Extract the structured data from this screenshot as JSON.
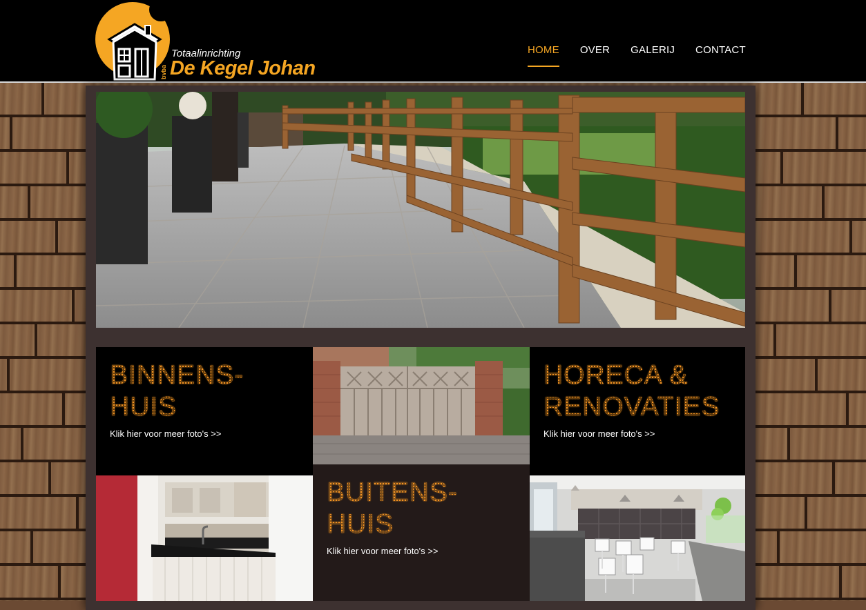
{
  "logo": {
    "tagline": "Totaalinrichting",
    "bvba": "bvba",
    "name": "De Kegel Johan"
  },
  "nav": {
    "items": [
      {
        "label": "HOME",
        "active": true
      },
      {
        "label": "OVER",
        "active": false
      },
      {
        "label": "GALERIJ",
        "active": false
      },
      {
        "label": "CONTACT",
        "active": false
      }
    ]
  },
  "colors": {
    "accent": "#f5a623",
    "title_orange": "#e48b1e",
    "header_bg": "#000000",
    "panel_bg": "#3d3130"
  },
  "tiles": {
    "binnenshuis": {
      "title": "BINNENS-\nHUIS",
      "link": "Klik hier voor meer foto's >>"
    },
    "buitenshuis": {
      "title": "BUITENS-\nHUIS",
      "link": "Klik hier voor meer foto's >>"
    },
    "horeca": {
      "title": "HORECA &\nRENOVATIES",
      "link": "Klik hier voor meer foto's >>"
    }
  }
}
